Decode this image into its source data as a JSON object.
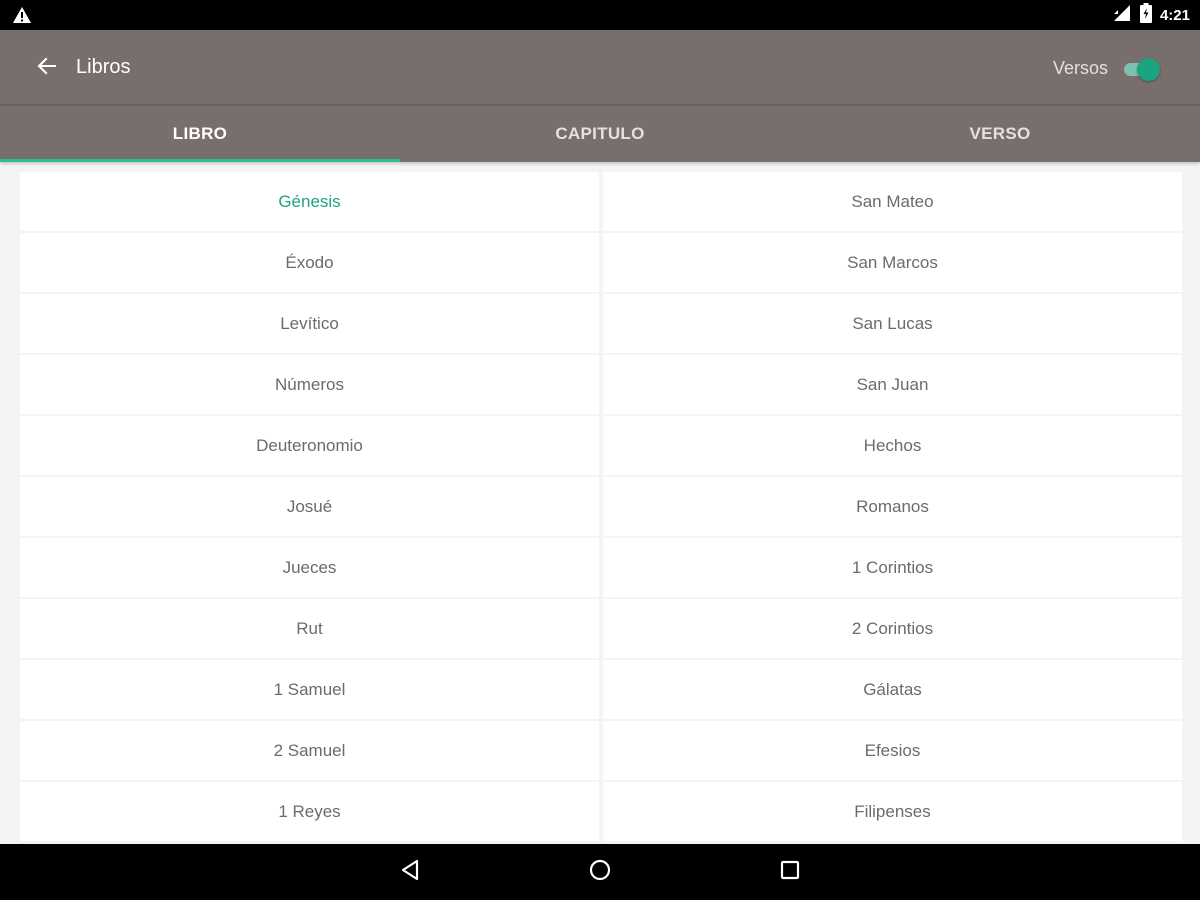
{
  "status_bar": {
    "time": "4:21"
  },
  "app_bar": {
    "title": "Libros",
    "toggle_label": "Versos",
    "toggle_on": true
  },
  "tabs": [
    {
      "label": "LIBRO",
      "active": true
    },
    {
      "label": "CAPITULO",
      "active": false
    },
    {
      "label": "VERSO",
      "active": false
    }
  ],
  "books": {
    "left": [
      {
        "label": "Génesis",
        "selected": true
      },
      {
        "label": "Éxodo"
      },
      {
        "label": "Levítico"
      },
      {
        "label": "Números"
      },
      {
        "label": "Deuteronomio"
      },
      {
        "label": "Josué"
      },
      {
        "label": "Jueces"
      },
      {
        "label": "Rut"
      },
      {
        "label": "1 Samuel"
      },
      {
        "label": "2 Samuel"
      },
      {
        "label": "1 Reyes"
      }
    ],
    "right": [
      {
        "label": "San Mateo"
      },
      {
        "label": "San Marcos"
      },
      {
        "label": "San Lucas"
      },
      {
        "label": "San Juan"
      },
      {
        "label": "Hechos"
      },
      {
        "label": "Romanos"
      },
      {
        "label": "1 Corintios"
      },
      {
        "label": "2 Corintios"
      },
      {
        "label": "Gálatas"
      },
      {
        "label": "Efesios"
      },
      {
        "label": "Filipenses"
      }
    ]
  },
  "colors": {
    "app_bar": "#786f6d",
    "accent": "#2bbf98",
    "selected_text": "#20a383",
    "item_text": "#6b6b6b"
  },
  "icons": {
    "status_left": "warning-icon",
    "status_right": [
      "signal-icon",
      "battery-icon"
    ],
    "back": "arrow-left-icon",
    "nav": [
      "back-triangle-icon",
      "home-circle-icon",
      "recents-square-icon"
    ]
  }
}
